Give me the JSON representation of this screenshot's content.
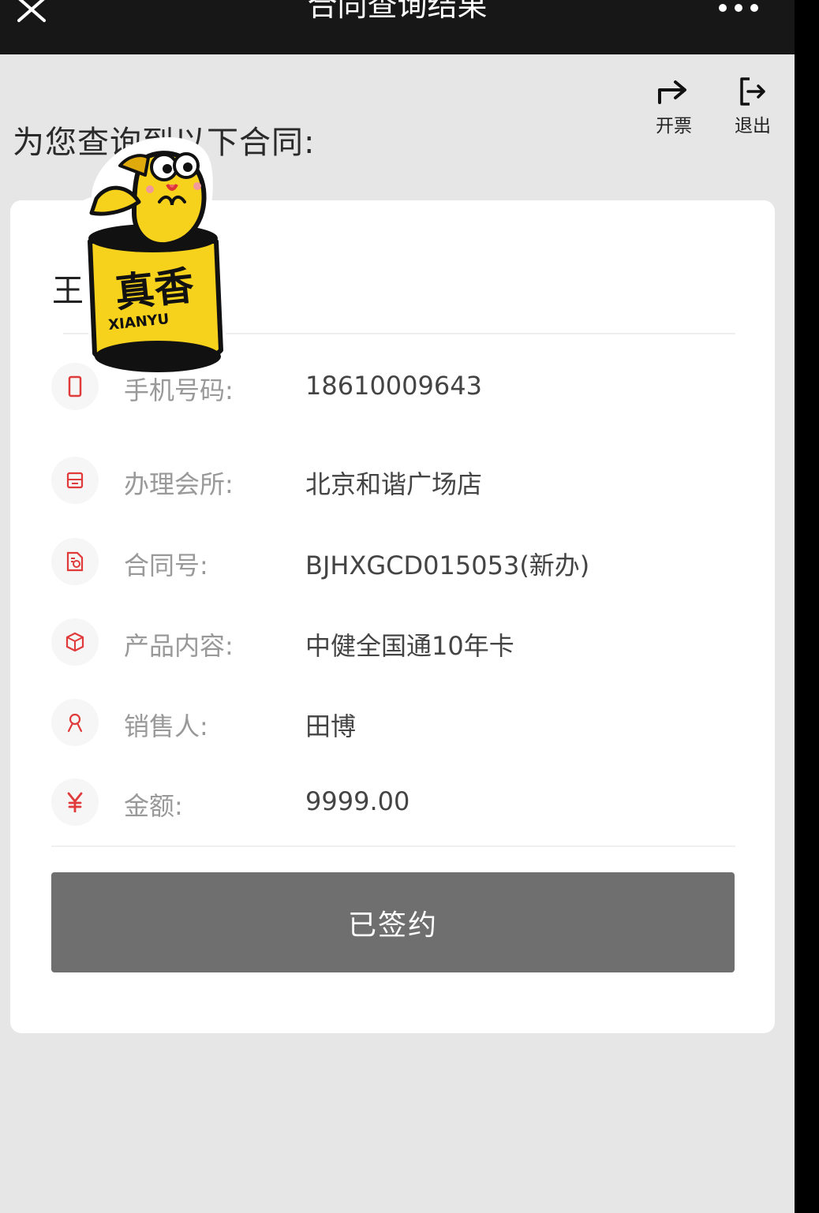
{
  "navbar": {
    "title": "合同查询结果"
  },
  "actions": [
    {
      "label": "开票",
      "icon": "arrow-right-icon"
    },
    {
      "label": "退出",
      "icon": "logout-icon"
    }
  ],
  "headline": "为您查询到以下合同:",
  "card": {
    "customer_name": "王",
    "rows": [
      {
        "icon": "phone-icon",
        "label": "手机号码:",
        "value": "18610009643"
      },
      {
        "icon": "store-icon",
        "label": "办理会所:",
        "value": "北京和谐广场店"
      },
      {
        "icon": "contract-icon",
        "label": "合同号:",
        "value": "BJHXGCD015053(新办)"
      },
      {
        "icon": "box-icon",
        "label": "产品内容:",
        "value": "中健全国通10年卡"
      },
      {
        "icon": "person-icon",
        "label": "销售人:",
        "value": "田博"
      },
      {
        "icon": "yuan-icon",
        "label": "金额:",
        "value": "9999.00"
      }
    ],
    "status_button": "已签约"
  },
  "sticker": {
    "text_big": "真香",
    "text_small": "XIANYU"
  },
  "colors": {
    "accent_red": "#e03a3a",
    "button_gray": "#6f6f6f",
    "navbar": "#171717",
    "sticker_yellow": "#f7d21c"
  }
}
